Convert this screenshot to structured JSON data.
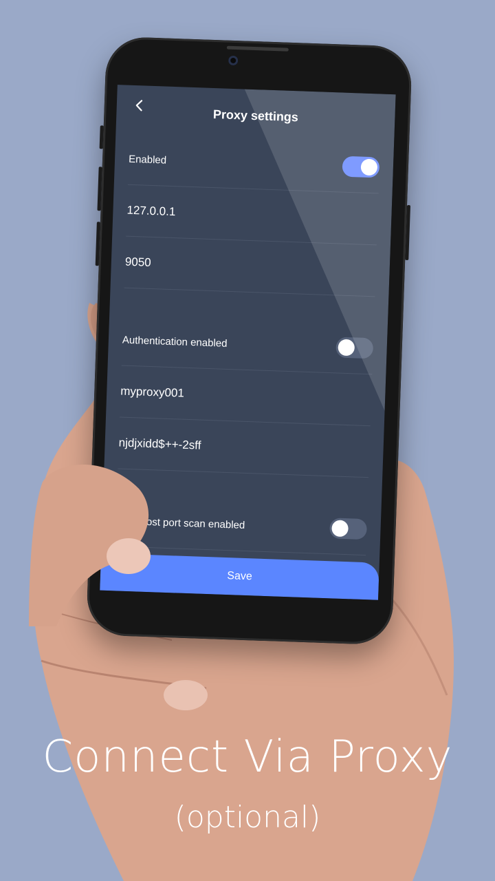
{
  "screen": {
    "title": "Proxy settings",
    "back_icon": "chevron-left-icon"
  },
  "proxy": {
    "enabled_label": "Enabled",
    "enabled": true,
    "host": "127.0.0.1",
    "port": "9050"
  },
  "auth": {
    "enabled_label": "Authentication enabled",
    "enabled": false,
    "username": "myproxy001",
    "password": "njdjxidd$++-2sff"
  },
  "scan": {
    "enabled_label": "Localhost port scan enabled",
    "enabled": false
  },
  "save_label": "Save",
  "caption": {
    "headline": "Connect Via Proxy",
    "subline": "(optional)"
  },
  "colors": {
    "background": "#9aa9c8",
    "screen": "#3a4559",
    "accent": "#5b86ff",
    "toggle_on": "#6a8bff",
    "toggle_off": "#56627a"
  }
}
